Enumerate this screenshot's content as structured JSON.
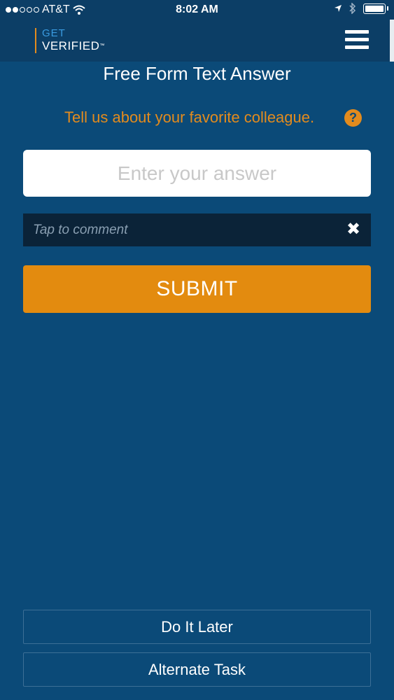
{
  "status_bar": {
    "carrier": "AT&T",
    "time": "8:02 AM",
    "signal_icon": "signal-dots-icon",
    "wifi_icon": "wifi-icon",
    "location_icon": "location-arrow-icon",
    "bluetooth_icon": "bluetooth-icon",
    "battery_icon": "battery-icon"
  },
  "header": {
    "logo_get": "GET",
    "logo_verified": "VERIFIED",
    "logo_tm": "™",
    "menu_icon": "hamburger-menu-icon"
  },
  "page": {
    "title": "Free Form Text Answer",
    "question": "Tell us about your favorite colleague.",
    "help_icon": "question-circle-icon",
    "help_glyph": "?"
  },
  "form": {
    "answer_placeholder": "Enter your answer",
    "answer_value": "",
    "comment_placeholder": "Tap to comment",
    "comment_value": "",
    "clear_glyph": "✖",
    "submit_label": "SUBMIT"
  },
  "footer": {
    "later_label": "Do It Later",
    "alternate_label": "Alternate Task"
  },
  "colors": {
    "background": "#0b4a78",
    "header": "#0c3e66",
    "accent": "#e38b0f",
    "comment_bar": "#0b2338"
  }
}
